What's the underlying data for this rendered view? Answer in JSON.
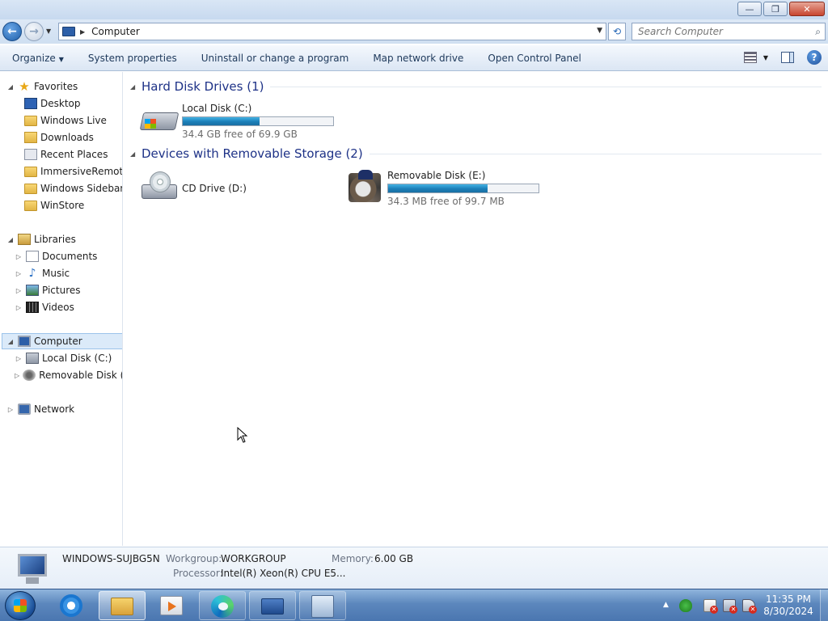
{
  "window": {
    "minimize_glyph": "—",
    "maximize_glyph": "❐",
    "close_glyph": "✕"
  },
  "address": {
    "path": "Computer",
    "search_placeholder": "Search Computer",
    "icons": [
      "back-arrow-icon",
      "forward-arrow-icon",
      "computer-icon",
      "refresh-icon",
      "magnifier-icon"
    ]
  },
  "toolbar": {
    "organize": "Organize",
    "system_properties": "System properties",
    "uninstall": "Uninstall or change a program",
    "map_drive": "Map network drive",
    "control_panel": "Open Control Panel",
    "help_glyph": "?"
  },
  "nav": {
    "favorites": {
      "label": "Favorites",
      "items": [
        {
          "label": "Desktop",
          "icon": "desktop-icon"
        },
        {
          "label": "Windows Live",
          "icon": "folder-icon"
        },
        {
          "label": "Downloads",
          "icon": "downloads-icon"
        },
        {
          "label": "Recent Places",
          "icon": "recent-places-icon"
        },
        {
          "label": "ImmersiveRemoteD",
          "icon": "folder-icon"
        },
        {
          "label": "Windows Sidebar",
          "icon": "folder-icon"
        },
        {
          "label": "WinStore",
          "icon": "folder-icon"
        }
      ]
    },
    "libraries": {
      "label": "Libraries",
      "items": [
        {
          "label": "Documents",
          "icon": "documents-icon"
        },
        {
          "label": "Music",
          "icon": "music-icon"
        },
        {
          "label": "Pictures",
          "icon": "pictures-icon"
        },
        {
          "label": "Videos",
          "icon": "videos-icon"
        }
      ]
    },
    "computer": {
      "label": "Computer",
      "items": [
        {
          "label": "Local Disk (C:)",
          "icon": "hard-disk-icon"
        },
        {
          "label": "Removable Disk (E:)",
          "icon": "removable-disk-icon"
        }
      ]
    },
    "network": {
      "label": "Network"
    }
  },
  "content": {
    "hdd_group": "Hard Disk Drives (1)",
    "removable_group": "Devices with Removable Storage (2)",
    "drives": {
      "c": {
        "name": "Local Disk (C:)",
        "free": "34.4 GB free of 69.9 GB",
        "used_fraction": 0.51
      },
      "d": {
        "name": "CD Drive (D:)"
      },
      "e": {
        "name": "Removable Disk (E:)",
        "free": "34.3 MB free of 99.7 MB",
        "used_fraction": 0.66
      }
    }
  },
  "details": {
    "computer_name": "WINDOWS-SUJBG5N",
    "workgroup_label": "Workgroup:",
    "workgroup": "WORKGROUP",
    "memory_label": "Memory:",
    "memory": "6.00 GB",
    "processor_label": "Processor:",
    "processor": "Intel(R) Xeon(R) CPU E5..."
  },
  "taskbar": {
    "time": "11:35 PM",
    "date": "8/30/2024",
    "tray_up_glyph": "▲",
    "apps": [
      "internet-explorer-icon",
      "windows-explorer-icon",
      "media-player-icon",
      "edge-icon",
      "server-manager-icon",
      "remote-desktop-icon"
    ]
  },
  "colors": {
    "group_header": "#1e3287",
    "bar_fill": "#1b7eb8",
    "selection": "#dbeaf9",
    "taskbar": "#5c87bd"
  }
}
